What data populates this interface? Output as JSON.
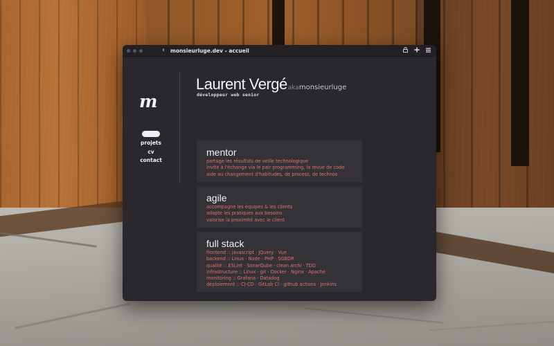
{
  "window": {
    "url": "monsieurluge.dev - accueil",
    "icons": [
      "back-chevron-icon",
      "lock-icon",
      "plus-icon",
      "menu-icon"
    ]
  },
  "sidebar": {
    "logo": "m",
    "nav": [
      {
        "label": "projets"
      },
      {
        "label": "cv"
      },
      {
        "label": "contact"
      }
    ]
  },
  "header": {
    "name": "Laurent Vergé",
    "aka": "aka",
    "handle": "monsieurluge",
    "subtitle": "développeur web senior"
  },
  "cards": [
    {
      "title": "mentor",
      "lines": [
        "partage les résultats de veille technologique",
        "invite à l'échange via le pair programming, la revue de code",
        "aide au changement d'habitudes, de process, de technos"
      ]
    },
    {
      "title": "agile",
      "lines": [
        "accompagne les équipes & les clients",
        "adapte les pratiques aux besoins",
        "valorise la proximité avec le client"
      ]
    },
    {
      "title": "full stack",
      "lines": [
        "frontend :: javascript · JQuery · Vue",
        "backend :: Linux · Node · PHP · SGBDR",
        "qualité :: ESLint · SonarQube · clean archi · TDD",
        "infrastructure :: Linux · git · Docker · Nginx · Apache",
        "monitoring :: Grafana · Datadog",
        "déploiement :: CI-CD · GitLab CI · github actions · Jenkins"
      ]
    }
  ],
  "colors": {
    "accent": "#e0736d",
    "window_bg": "#2a282d",
    "card_bg": "#343237"
  }
}
